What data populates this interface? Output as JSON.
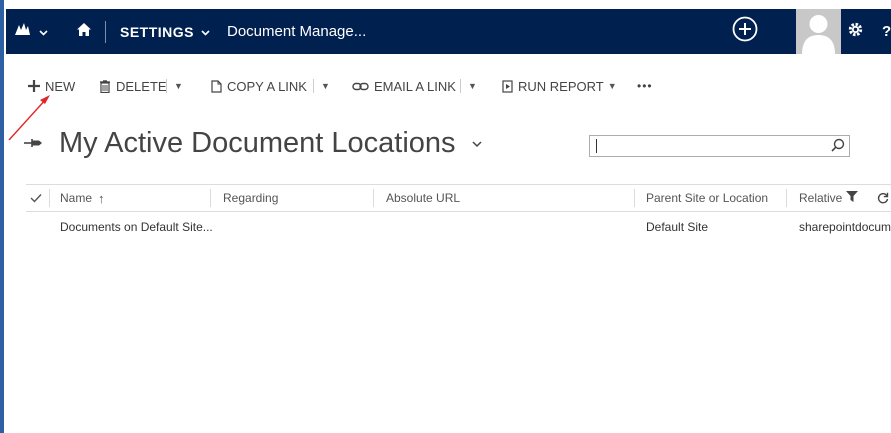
{
  "nav": {
    "settings_label": "SETTINGS",
    "area_title": "Document Manage...",
    "bar_color": "#002050"
  },
  "commands": {
    "new_label": "NEW",
    "delete_label": "DELETE",
    "copy_link_label": "COPY A LINK",
    "email_link_label": "EMAIL A LINK",
    "run_report_label": "RUN REPORT",
    "more_label": "•••"
  },
  "view": {
    "title": "My Active Document Locations",
    "chevron": "⌄"
  },
  "search": {
    "placeholder": ""
  },
  "grid": {
    "columns": [
      "Name",
      "Regarding",
      "Absolute URL",
      "Parent Site or Location",
      "Relative"
    ],
    "sort_indicator": "↑",
    "rows": [
      {
        "name": "Documents on Default Site...",
        "regarding": "",
        "absolute_url": "",
        "parent_site": "Default Site",
        "relative": "sharepointdocum"
      }
    ]
  },
  "annotation": {
    "arrow_color": "#e0252b"
  }
}
